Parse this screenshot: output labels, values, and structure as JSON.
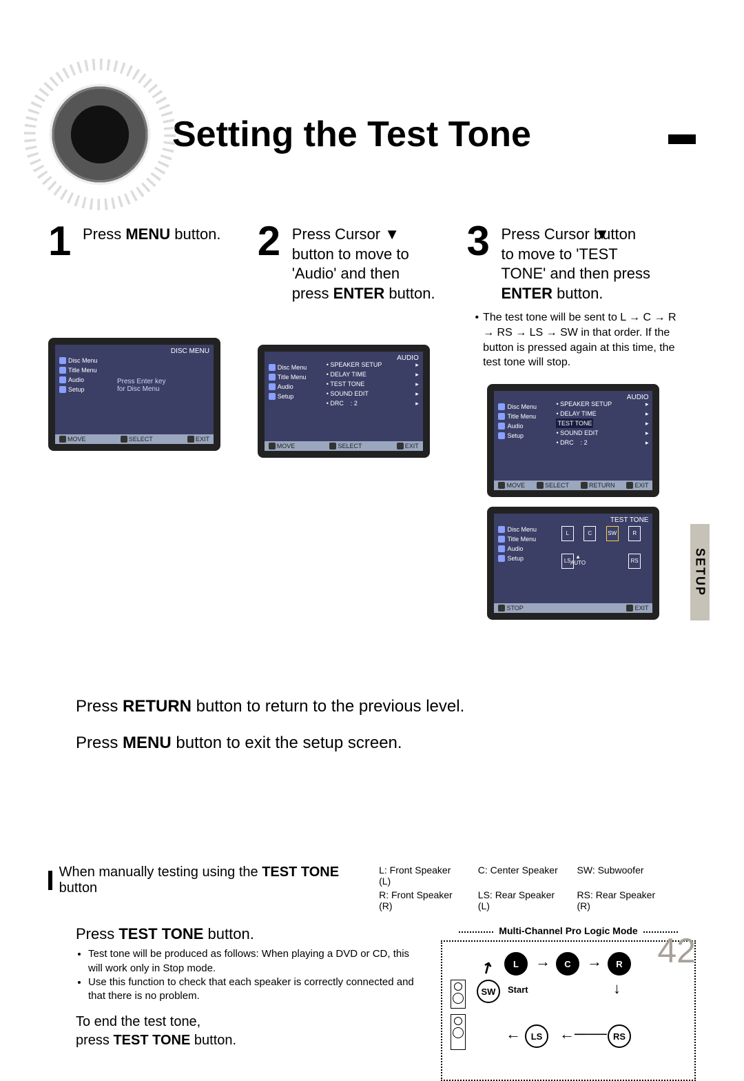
{
  "title": "Setting the Test Tone",
  "sideTab": "SETUP",
  "pageNumber": "42",
  "steps": {
    "s1": {
      "num": "1",
      "text_pre": "Press ",
      "text_bold": "MENU",
      "text_post": " button."
    },
    "s2": {
      "num": "2",
      "line1": "Press Cursor ",
      "line2": "button to move to",
      "line3a": "'Audio' and then",
      "line3b_pre": "press ",
      "line3b_bold": "ENTER",
      "line3b_post": " button."
    },
    "s3": {
      "num": "3",
      "line1": "Press Cursor    button",
      "line2": "to move to 'TEST",
      "line3": "TONE' and then press",
      "line4_bold": "ENTER",
      "line4_post": " button."
    },
    "s3_note": "The test tone will be sent to L → C → R → RS → LS → SW in that order. If the button is pressed again at this time, the test tone will stop."
  },
  "screens": {
    "menu_sidebar": {
      "i1": "Disc Menu",
      "i2": "Title Menu",
      "i3": "Audio",
      "i4": "Setup"
    },
    "s1": {
      "title": "DISC MENU",
      "hint1": "Press Enter key",
      "hint2": "for Disc Menu",
      "bottom": {
        "move": "MOVE",
        "select": "SELECT",
        "exit": "EXIT"
      }
    },
    "s2": {
      "title": "AUDIO",
      "rows": {
        "r1": "SPEAKER SETUP",
        "r2": "DELAY TIME",
        "r3": "TEST TONE",
        "r4": "SOUND EDIT",
        "r5": "DRC",
        "r5v": ": 2"
      },
      "bottom": {
        "move": "MOVE",
        "select": "SELECT",
        "exit": "EXIT"
      }
    },
    "s3a": {
      "title": "AUDIO",
      "rows": {
        "r1": "SPEAKER SETUP",
        "r2": "DELAY TIME",
        "r3": "TEST TONE",
        "r4": "SOUND EDIT",
        "r5": "DRC",
        "r5v": ": 2"
      },
      "bottom": {
        "move": "MOVE",
        "select": "SELECT",
        "return": "RETURN",
        "exit": "EXIT"
      }
    },
    "s3b": {
      "title": "TEST TONE",
      "center": "AUTO",
      "sp": {
        "l": "L",
        "c": "C",
        "sw": "SW",
        "r": "R",
        "ls": "LS",
        "rs": "RS"
      },
      "bottom": {
        "stop": "STOP",
        "exit": "EXIT"
      }
    }
  },
  "navLines": {
    "l1_pre": "Press ",
    "l1_bold": "RETURN",
    "l1_post": " button to return to the previous level.",
    "l2_pre": "Press ",
    "l2_bold": "MENU",
    "l2_post": " button to exit the setup screen."
  },
  "band": {
    "header": "When manually testing using the ",
    "header_bold": "TEST TONE",
    "header_post": " button",
    "legend": {
      "L": "L: Front Speaker (L)",
      "C": "C: Center Speaker",
      "SW": "SW: Subwoofer",
      "R": "R: Front Speaker (R)",
      "LS": "LS: Rear Speaker (L)",
      "RS": "RS: Rear Speaker (R)"
    },
    "pressTitle_pre": "Press ",
    "pressTitle_bold": "TEST TONE",
    "pressTitle_post": " button.",
    "b1": "Test tone will be produced as follows: When playing a DVD or CD, this will work only in Stop mode.",
    "b2": "Use this function to check that each speaker is correctly connected and that there is no problem.",
    "end_l1": "To end the test tone,",
    "end_l2_pre": "press ",
    "end_l2_bold": "TEST TONE",
    "end_l2_post": " button.",
    "modeLabel": "Multi-Channel Pro Logic Mode",
    "nodes": {
      "L": "L",
      "C": "C",
      "R": "R",
      "SW": "SW",
      "LS": "LS",
      "RS": "RS"
    },
    "start": "Start"
  }
}
